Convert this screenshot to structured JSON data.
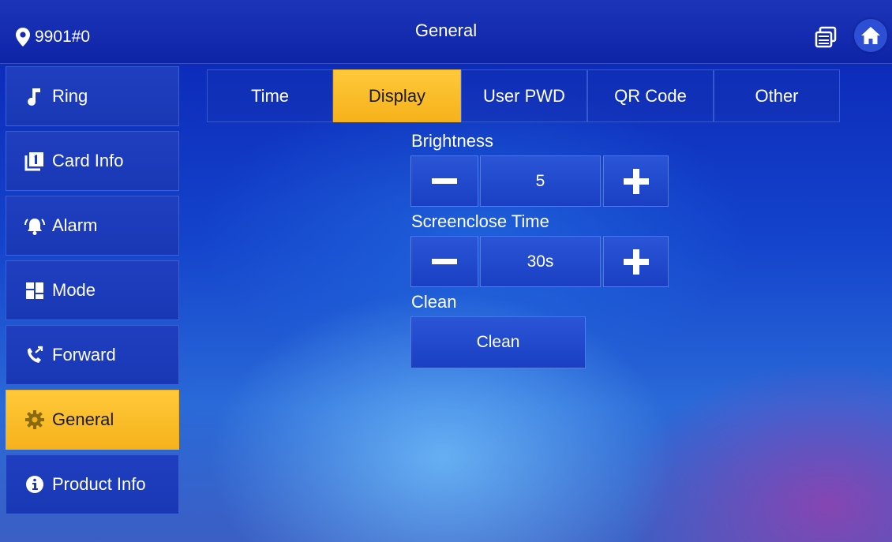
{
  "header": {
    "location": "9901#0",
    "title": "General"
  },
  "sidebar": {
    "items": [
      {
        "label": "Ring",
        "icon": "music-note-icon"
      },
      {
        "label": "Card Info",
        "icon": "card-icon"
      },
      {
        "label": "Alarm",
        "icon": "alarm-bell-icon"
      },
      {
        "label": "Mode",
        "icon": "mode-grid-icon"
      },
      {
        "label": "Forward",
        "icon": "call-forward-icon"
      },
      {
        "label": "General",
        "icon": "gear-icon",
        "active": true
      },
      {
        "label": "Product Info",
        "icon": "info-icon"
      }
    ]
  },
  "tabs": [
    {
      "label": "Time"
    },
    {
      "label": "Display",
      "active": true
    },
    {
      "label": "User PWD"
    },
    {
      "label": "QR Code"
    },
    {
      "label": "Other"
    }
  ],
  "settings": {
    "brightness": {
      "label": "Brightness",
      "value": "5"
    },
    "screenclose": {
      "label": "Screenclose Time",
      "value": "30s"
    },
    "clean": {
      "label": "Clean",
      "button": "Clean"
    }
  },
  "colors": {
    "accent": "#f6b21b",
    "bar": "#0e24a8",
    "panel": "#1a3fc2"
  }
}
